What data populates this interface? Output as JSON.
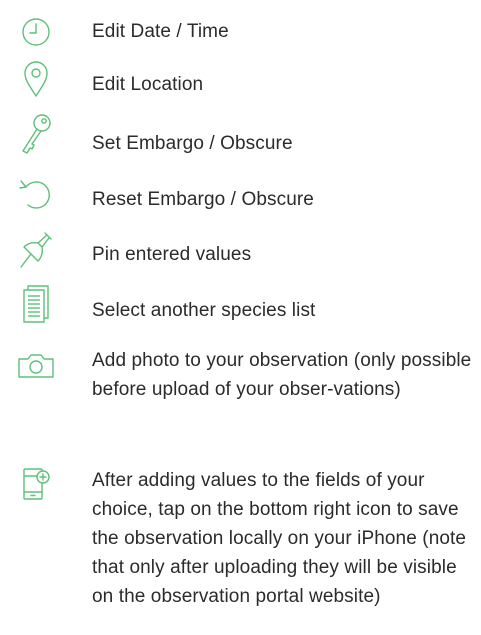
{
  "colors": {
    "icon": "#5dc07a",
    "text": "#2b2b2b"
  },
  "items": [
    {
      "icon": "clock-icon",
      "label": "Edit Date / Time"
    },
    {
      "icon": "location-pin-icon",
      "label": "Edit Location"
    },
    {
      "icon": "key-icon",
      "label": "Set Embargo / Obscure"
    },
    {
      "icon": "reset-icon",
      "label": "Reset Embargo / Obscure"
    },
    {
      "icon": "pushpin-icon",
      "label": "Pin entered values"
    },
    {
      "icon": "document-list-icon",
      "label": "Select another species list"
    },
    {
      "icon": "camera-icon",
      "label": "Add photo to your observation (only possible before upload of your obser-vations)"
    },
    {
      "icon": "phone-save-icon",
      "label": "After adding values to the fields of your choice, tap on the bottom right icon to save the observation locally on your iPhone (note that only after uploading they will be visible on the observation portal website)"
    }
  ]
}
